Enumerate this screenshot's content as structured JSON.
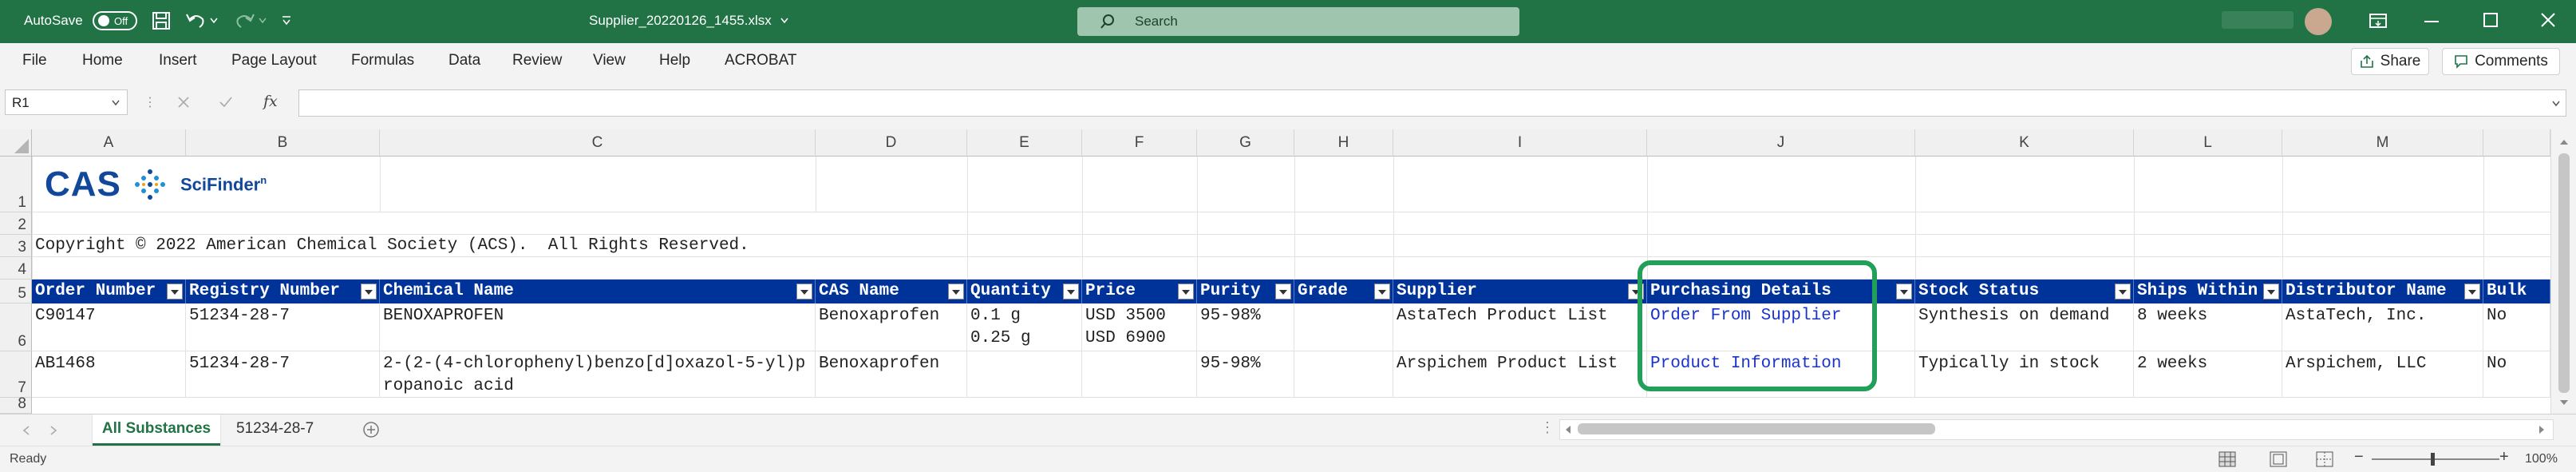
{
  "titlebar": {
    "autosave_label": "AutoSave",
    "autosave_state": "Off",
    "filename": "Supplier_20220126_1455.xlsx",
    "search_placeholder": "Search"
  },
  "ribbon": {
    "tabs": [
      "File",
      "Home",
      "Insert",
      "Page Layout",
      "Formulas",
      "Data",
      "Review",
      "View",
      "Help",
      "ACROBAT"
    ],
    "share_label": "Share",
    "comments_label": "Comments"
  },
  "formula_bar": {
    "name_box": "R1",
    "fx_label": "fx",
    "formula": ""
  },
  "columns": [
    "A",
    "B",
    "C",
    "D",
    "E",
    "F",
    "G",
    "H",
    "I",
    "J",
    "K",
    "L",
    "M"
  ],
  "rows": [
    "1",
    "2",
    "3",
    "4",
    "5",
    "6",
    "7",
    "8"
  ],
  "logo": {
    "cas": "CAS",
    "scifinder": "SciFinder",
    "superscript": "n"
  },
  "copyright": "Copyright © 2022 American Chemical Society (ACS).  All Rights Reserved.",
  "table": {
    "headers": [
      "Order Number",
      "Registry Number",
      "Chemical Name",
      "CAS Name",
      "Quantity",
      "Price",
      "Purity",
      "Grade",
      "Supplier",
      "Purchasing Details",
      "Stock Status",
      "Ships Within",
      "Distributor Name",
      "Bulk"
    ],
    "rows": [
      {
        "order": "C90147",
        "registry": "51234-28-7",
        "chemical": "BENOXAPROFEN",
        "cas_name": "Benoxaprofen",
        "quantity": [
          "0.1 g",
          "0.25 g"
        ],
        "price": [
          "USD 3500",
          "USD 6900"
        ],
        "purity": "95-98%",
        "grade": "",
        "supplier": "AstaTech Product List",
        "details": "Order From Supplier",
        "stock": "Synthesis on demand",
        "ships": "8 weeks",
        "distributor": "AstaTech, Inc.",
        "bulk": "No"
      },
      {
        "order": "AB1468",
        "registry": "51234-28-7",
        "chemical": "2-(2-(4-chlorophenyl)benzo[d]oxazol-5-yl)propanoic acid",
        "cas_name": "Benoxaprofen",
        "quantity": [
          ""
        ],
        "price": [
          ""
        ],
        "purity": "95-98%",
        "grade": "",
        "supplier": "Arspichem Product List",
        "details": "Product Information",
        "stock": "Typically in stock",
        "ships": "2 weeks",
        "distributor": "Arspichem, LLC",
        "bulk": "No"
      }
    ]
  },
  "sheets": {
    "active": "All Substances",
    "other": "51234-28-7"
  },
  "status": {
    "ready": "Ready",
    "zoom": "100%"
  },
  "colors": {
    "excel_green": "#217346",
    "header_blue": "#003399",
    "highlight_green": "#22a05a",
    "link_blue": "#1a33cc"
  }
}
